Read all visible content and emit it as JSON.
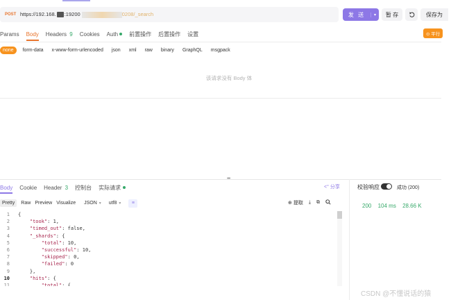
{
  "request": {
    "method": "POST",
    "url_prefix": "https://192.168.",
    "url_port": ":19200",
    "url_suffix": "0208/_search",
    "send_label": "发 送",
    "save_label": "暂 存",
    "save_as_label": "保存为",
    "tabs": [
      {
        "label": "Params"
      },
      {
        "label": "Body"
      },
      {
        "label": "Headers",
        "count": "9"
      },
      {
        "label": "Cookies"
      },
      {
        "label": "Auth"
      },
      {
        "label": "前置操作"
      },
      {
        "label": "后置操作"
      },
      {
        "label": "设置"
      }
    ],
    "right_badge": "⊙ 平行",
    "body_types": [
      "none",
      "form-data",
      "x-www-form-urlencoded",
      "json",
      "xml",
      "raw",
      "binary",
      "GraphQL",
      "msgpack"
    ],
    "empty_body_text": "该请求没有 Body 体"
  },
  "response": {
    "tabs": [
      {
        "label": "Body"
      },
      {
        "label": "Cookie"
      },
      {
        "label": "Header",
        "count": "3"
      },
      {
        "label": "控制台"
      },
      {
        "label": "实际请求"
      }
    ],
    "share_label": "分享",
    "view_modes": [
      "Pretty",
      "Raw",
      "Preview",
      "Visualize"
    ],
    "format_select": "JSON",
    "encoding_select": "utf8",
    "extract_label": "提取",
    "validate_label": "校验响应",
    "validate_result": "成功 (200)",
    "status_code": "200",
    "time": "104 ms",
    "size": "28.66 K",
    "code_lines": [
      {
        "no": "1",
        "indent": "",
        "parts": [
          [
            "p",
            "{"
          ]
        ]
      },
      {
        "no": "2",
        "indent": "    ",
        "parts": [
          [
            "k",
            "\"took\""
          ],
          [
            "p",
            ": 1,"
          ]
        ]
      },
      {
        "no": "3",
        "indent": "    ",
        "parts": [
          [
            "k",
            "\"timed_out\""
          ],
          [
            "p",
            ": false,"
          ]
        ]
      },
      {
        "no": "4",
        "indent": "    ",
        "parts": [
          [
            "k",
            "\"_shards\""
          ],
          [
            "p",
            ": {"
          ]
        ]
      },
      {
        "no": "5",
        "indent": "        ",
        "parts": [
          [
            "k",
            "\"total\""
          ],
          [
            "p",
            ": 10,"
          ]
        ]
      },
      {
        "no": "6",
        "indent": "        ",
        "parts": [
          [
            "k",
            "\"successful\""
          ],
          [
            "p",
            ": 10,"
          ]
        ]
      },
      {
        "no": "7",
        "indent": "        ",
        "parts": [
          [
            "k",
            "\"skipped\""
          ],
          [
            "p",
            ": 0,"
          ]
        ]
      },
      {
        "no": "8",
        "indent": "        ",
        "parts": [
          [
            "k",
            "\"failed\""
          ],
          [
            "p",
            ": 0"
          ]
        ]
      },
      {
        "no": "9",
        "indent": "    ",
        "parts": [
          [
            "p",
            "},"
          ]
        ]
      },
      {
        "no": "10",
        "indent": "    ",
        "parts": [
          [
            "k",
            "\"hits\""
          ],
          [
            "p",
            ": {"
          ]
        ],
        "bold": true
      },
      {
        "no": "11",
        "indent": "        ",
        "parts": [
          [
            "k",
            "\"total\""
          ],
          [
            "p",
            ": {"
          ]
        ]
      }
    ]
  },
  "watermark": "CSDN @不懂说话的猿",
  "colors": {
    "accent": "#8d78e6",
    "orange": "#f7931e",
    "success": "#37a96a"
  }
}
